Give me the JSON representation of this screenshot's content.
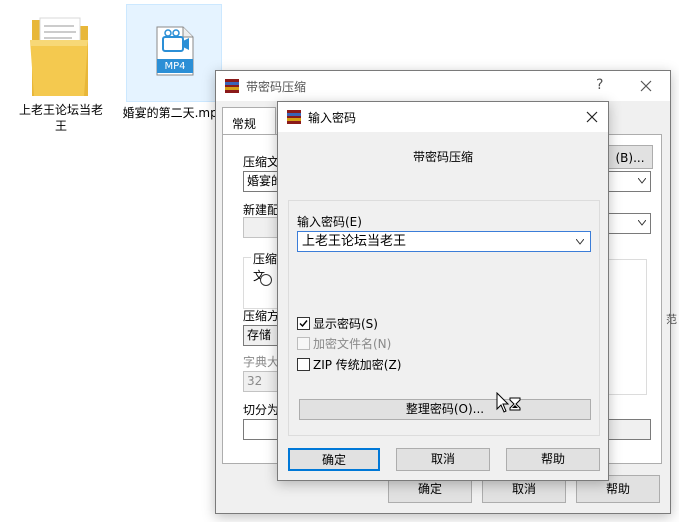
{
  "desktop": {
    "folder_label": "上老王论坛当老王",
    "mp4_badge": "MP4",
    "mp4_label": "婚宴的第二天.mp4"
  },
  "back_dialog": {
    "title": "带密码压缩",
    "help_glyph": "?",
    "tab_general": "常规",
    "browse_button": "(B)...",
    "label_archive_name": "压缩文",
    "archive_name_value": "婚宴的",
    "label_update_mode": "新建配",
    "group_archive_format": "压缩文",
    "label_compression_method": "压缩方",
    "compression_method_value": "存储",
    "label_dictionary_size": "字典大",
    "dictionary_size_value": "32",
    "label_split_volumes": "切分为",
    "side_fragment": "范",
    "ok": "确定",
    "cancel": "取消",
    "help": "帮助"
  },
  "front_dialog": {
    "title": "输入密码",
    "heading": "带密码压缩",
    "label_password": "输入密码(E)",
    "password_value": "上老王论坛当老王",
    "show_password": "显示密码(S)",
    "show_password_checked": true,
    "encrypt_filenames": "加密文件名(N)",
    "encrypt_filenames_checked": false,
    "zip_legacy": "ZIP 传统加密(Z)",
    "zip_legacy_checked": false,
    "organize_passwords": "整理密码(O)...",
    "ok": "确定",
    "cancel": "取消",
    "help": "帮助"
  },
  "colors": {
    "accent": "#0078d7",
    "folder": "#f4c94f",
    "mp4_blue": "#2b8fd6"
  }
}
